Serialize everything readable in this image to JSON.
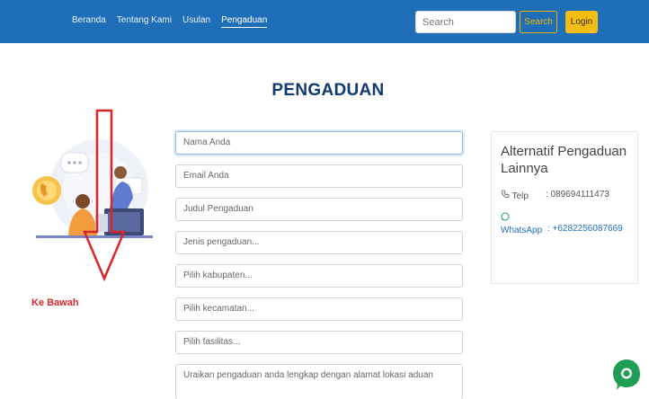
{
  "nav": {
    "items": [
      {
        "label": "Beranda"
      },
      {
        "label": "Tentang Kami"
      },
      {
        "label": "Usulan"
      },
      {
        "label": "Pengaduan",
        "active": true
      }
    ]
  },
  "search": {
    "placeholder": "Search",
    "button_label": "Search"
  },
  "login_label": "Login",
  "page_title": "PENGADUAN",
  "annotation": {
    "label": "Ke Bawah",
    "color": "#d9262a"
  },
  "form": {
    "name_placeholder": "Nama Anda",
    "email_placeholder": "Email Anda",
    "title_placeholder": "Judul Pengaduan",
    "type_select": "Jenis pengaduan...",
    "regency_select": "Pilih kabupaten...",
    "district_select": "Pilih kecamatan...",
    "facility_select": "Pilih fasilitas...",
    "description_placeholder": "Uraikan pengaduan anda lengkap dengan alamat lokasi aduan"
  },
  "alt_contact": {
    "title": "Alternatif Pengaduan Lainnya",
    "telp_label": "Telp",
    "telp_value": ": 089694111473",
    "whatsapp_label": "WhatsApp",
    "whatsapp_value": ": +6282256087669"
  },
  "colors": {
    "navbar": "#1f6fb8",
    "accent": "#f4bd12",
    "title": "#113a70",
    "whatsapp": "#1f9d55"
  }
}
